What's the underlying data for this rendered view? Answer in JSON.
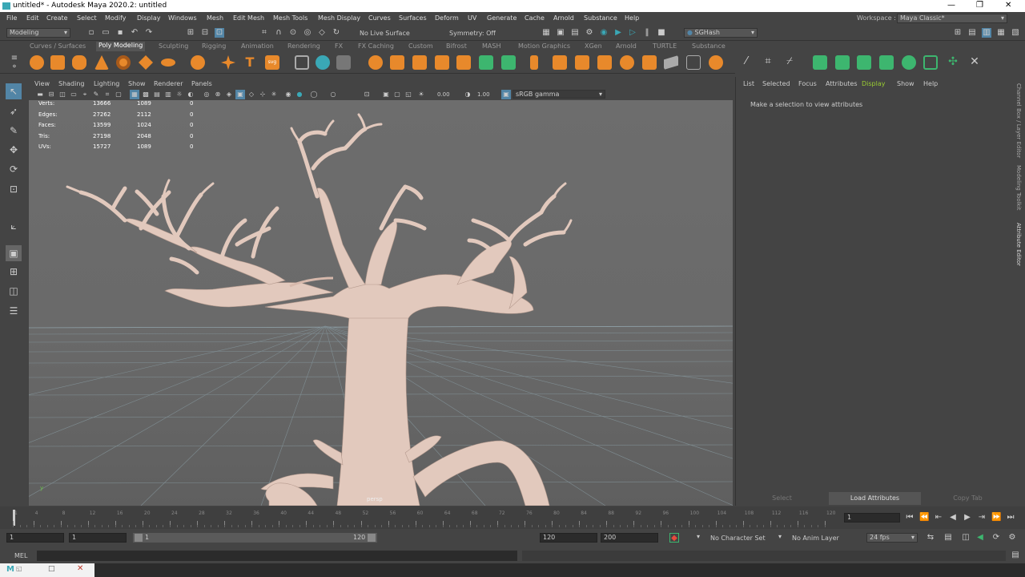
{
  "window": {
    "title": "untitled* - Autodesk Maya 2020.2: untitled",
    "controls": [
      "—",
      "❐",
      "✕"
    ]
  },
  "menubar": {
    "items": [
      "File",
      "Edit",
      "Create",
      "Select",
      "Modify",
      "Display",
      "Windows",
      "Mesh",
      "Edit Mesh",
      "Mesh Tools",
      "Mesh Display",
      "Curves",
      "Surfaces",
      "Deform",
      "UV",
      "Generate",
      "Cache",
      "Arnold",
      "Substance",
      "Help"
    ],
    "workspace_label": "Workspace :",
    "workspace_value": "Maya Classic*"
  },
  "statusline": {
    "mode": "Modeling",
    "live_surface": "No Live Surface",
    "symmetry": "Symmetry: Off",
    "sghash": "SGHash"
  },
  "shelf": {
    "tabs": [
      "Curves / Surfaces",
      "Poly Modeling",
      "Sculpting",
      "Rigging",
      "Animation",
      "Rendering",
      "FX",
      "FX Caching",
      "Custom",
      "Bifrost",
      "MASH",
      "Motion Graphics",
      "XGen",
      "Arnold",
      "TURTLE",
      "Substance"
    ],
    "active_tab": "Poly Modeling"
  },
  "viewport": {
    "menu": [
      "View",
      "Shading",
      "Lighting",
      "Show",
      "Renderer",
      "Panels"
    ],
    "exposure": "0.00",
    "gamma": "1.00",
    "color_space": "sRGB gamma",
    "camera": "persp",
    "hud": [
      {
        "label": "Verts:",
        "total": "13666",
        "selected": "1089",
        "faces": "0"
      },
      {
        "label": "Edges:",
        "total": "27262",
        "selected": "2112",
        "faces": "0"
      },
      {
        "label": "Faces:",
        "total": "13599",
        "selected": "1024",
        "faces": "0"
      },
      {
        "label": "Tris:",
        "total": "27198",
        "selected": "2048",
        "faces": "0"
      },
      {
        "label": "UVs:",
        "total": "15727",
        "selected": "1089",
        "faces": "0"
      }
    ]
  },
  "attribute_editor": {
    "menu": [
      "List",
      "Selected",
      "Focus",
      "Attributes",
      "Display",
      "Show",
      "Help"
    ],
    "active_menu": "Display",
    "message": "Make a selection to view attributes",
    "buttons": [
      "Select",
      "Load Attributes",
      "Copy Tab"
    ],
    "side_tabs": [
      "Channel Box / Layer Editor",
      "Modeling Toolkit",
      "Attribute Editor"
    ]
  },
  "timeline": {
    "ticks": [
      "1",
      "4",
      "8",
      "12",
      "16",
      "20",
      "24",
      "28",
      "32",
      "36",
      "40",
      "44",
      "48",
      "52",
      "56",
      "60",
      "64",
      "68",
      "72",
      "76",
      "80",
      "84",
      "88",
      "92",
      "96",
      "100",
      "104",
      "108",
      "112",
      "116",
      "120"
    ],
    "current_frame": "1"
  },
  "range": {
    "start": "1",
    "playback_start": "1",
    "slider_start": "1",
    "slider_end": "120",
    "playback_end": "120",
    "end": "200",
    "character_set": "No Character Set",
    "anim_layer": "No Anim Layer",
    "fps": "24 fps"
  },
  "command_line": {
    "language": "MEL"
  },
  "colors": {
    "accent_green": "#9acd32",
    "shelf_orange": "#e8892b",
    "shelf_green": "#3db66f",
    "maya_teal": "#3aa8b6",
    "tree": "#e2c9bd"
  }
}
